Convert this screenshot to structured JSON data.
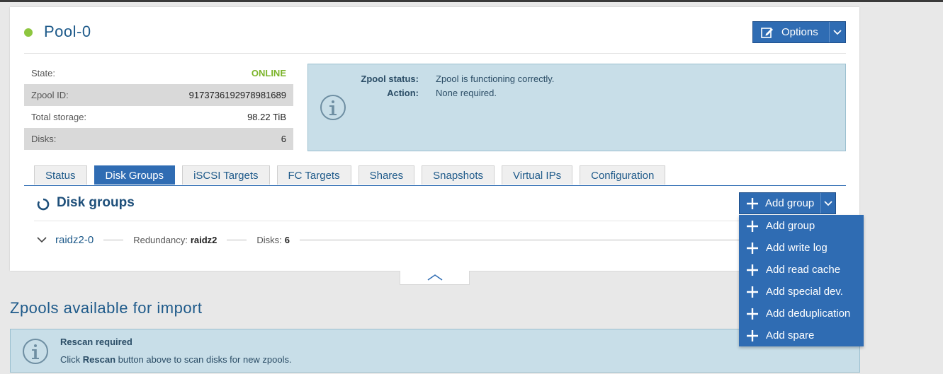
{
  "pool": {
    "name": "Pool-0",
    "status_color": "#8dc63f",
    "options_label": "Options"
  },
  "properties": [
    {
      "label": "State:",
      "value": "ONLINE"
    },
    {
      "label": "Zpool ID:",
      "value": "9173736192978981689"
    },
    {
      "label": "Total storage:",
      "value": "98.22 TiB"
    },
    {
      "label": "Disks:",
      "value": "6"
    }
  ],
  "zpool_status": {
    "status_label": "Zpool status:",
    "status_value": "Zpool is functioning correctly.",
    "action_label": "Action:",
    "action_value": "None required."
  },
  "tabs": [
    "Status",
    "Disk Groups",
    "iSCSI Targets",
    "FC Targets",
    "Shares",
    "Snapshots",
    "Virtual IPs",
    "Configuration"
  ],
  "active_tab": "Disk Groups",
  "disk_groups": {
    "title": "Disk groups",
    "add_group_label": "Add group",
    "group": {
      "name": "raidz2-0",
      "redundancy_label": "Redundancy:",
      "redundancy_value": "raidz2",
      "disks_label": "Disks:",
      "disks_value": "6"
    }
  },
  "dropdown": [
    "Add group",
    "Add write log",
    "Add read cache",
    "Add special dev.",
    "Add deduplication",
    "Add spare"
  ],
  "import": {
    "title": "Zpools available for import",
    "rescan_title": "Rescan required",
    "rescan_text_1": "Click ",
    "rescan_text_bold": "Rescan",
    "rescan_text_2": " button above to scan disks for new zpools."
  },
  "colors": {
    "accent": "#2f6cb3",
    "online": "#7cb42b",
    "info_bg": "#c8dee8"
  }
}
